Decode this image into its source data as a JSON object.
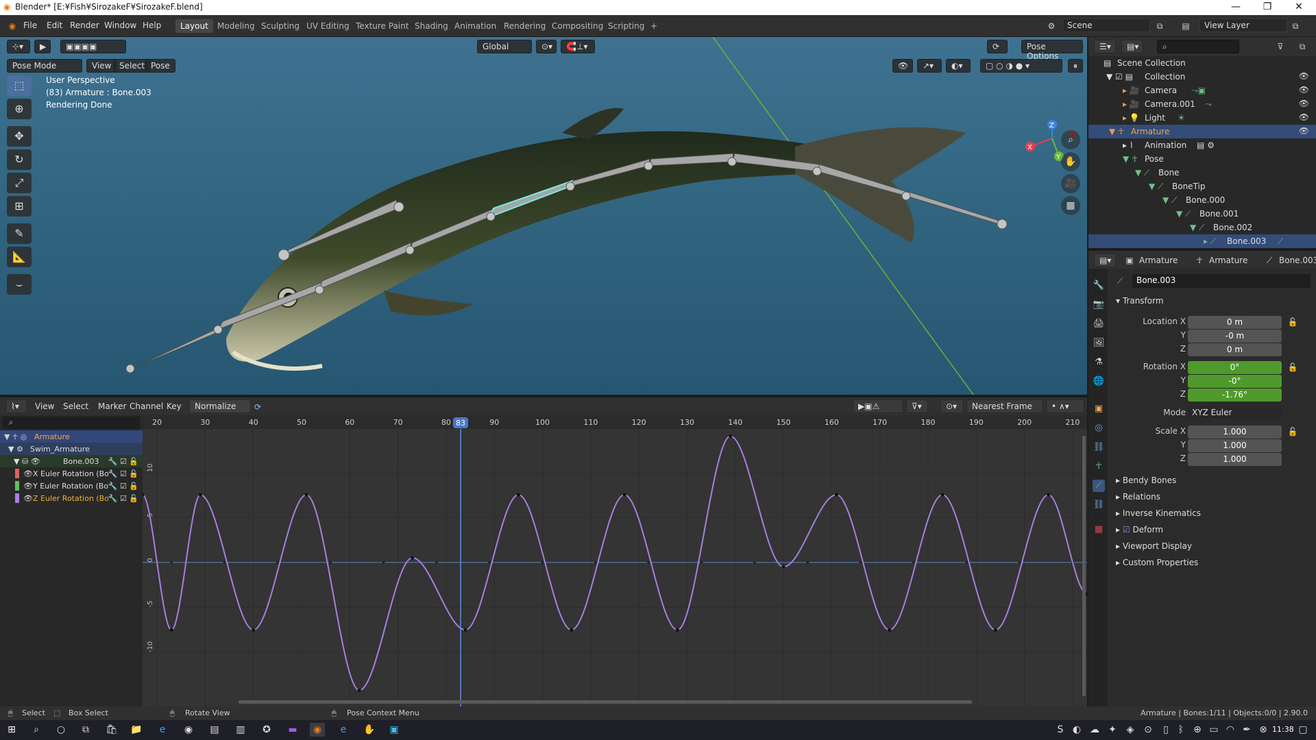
{
  "window": {
    "title": "Blender* [E:¥Fish¥SirozakeF¥SirozakeF.blend]"
  },
  "menu": [
    "File",
    "Edit",
    "Render",
    "Window",
    "Help"
  ],
  "workspaces": [
    "Layout",
    "Modeling",
    "Sculpting",
    "UV Editing",
    "Texture Paint",
    "Shading",
    "Animation",
    "Rendering",
    "Compositing",
    "Scripting",
    "+"
  ],
  "active_workspace": "Layout",
  "scene": {
    "label": "Scene",
    "view_layer": "View Layer"
  },
  "viewport": {
    "mode": "Pose Mode",
    "menus": [
      "View",
      "Select",
      "Pose"
    ],
    "orientation": "Global",
    "pose_options": "Pose Options",
    "info_line1": "User Perspective",
    "info_line2": "(83) Armature : Bone.003",
    "info_line3": "Rendering Done",
    "gizmo_axes": [
      "X",
      "Y",
      "Z"
    ]
  },
  "graph_editor": {
    "menus": [
      "View",
      "Select",
      "Marker",
      "Channel",
      "Key"
    ],
    "normalize": "Normalize",
    "snap": "Nearest Frame",
    "current_frame": 83,
    "frame_ticks": [
      20,
      30,
      40,
      50,
      60,
      70,
      80,
      90,
      100,
      110,
      120,
      130,
      140,
      150,
      160,
      170,
      180,
      190,
      200,
      210
    ],
    "value_ticks": [
      "10",
      "5",
      "0",
      "-5",
      "-10"
    ],
    "channels": [
      {
        "label": "Armature"
      },
      {
        "label": "Swim_Armature"
      },
      {
        "label": "Bone.003"
      },
      {
        "label": "X Euler Rotation (Bo"
      },
      {
        "label": "Y Euler Rotation (Bo"
      },
      {
        "label": "Z Euler Rotation (Bo"
      }
    ],
    "curve_color": "#a97fe0"
  },
  "chart_data": {
    "type": "line",
    "title": "",
    "xlabel": "",
    "ylabel": "",
    "xlim": [
      17,
      213
    ],
    "ylim": [
      -15,
      14.5
    ],
    "series": [
      {
        "name": "Z Euler Rotation",
        "x": [
          17,
          23,
          29,
          40,
          51,
          62,
          73,
          84,
          95,
          106,
          117,
          128,
          139,
          150,
          161,
          172,
          183,
          194,
          205,
          213
        ],
        "y": [
          7.5,
          -7.5,
          7.5,
          -7.5,
          7.5,
          -14.2,
          0.5,
          -7.5,
          7.5,
          -7.5,
          7.5,
          -7.5,
          14,
          -0.5,
          7.5,
          -7.5,
          7.5,
          -7.5,
          7.5,
          -3.5
        ]
      }
    ]
  },
  "outliner": {
    "rows": [
      {
        "label": "Scene Collection"
      },
      {
        "label": "Collection"
      },
      {
        "label": "Camera"
      },
      {
        "label": "Camera.001"
      },
      {
        "label": "Light"
      },
      {
        "label": "Armature"
      },
      {
        "label": "Animation"
      },
      {
        "label": "Pose"
      },
      {
        "label": "Bone"
      },
      {
        "label": "BoneTip"
      },
      {
        "label": "Bone.000"
      },
      {
        "label": "Bone.001"
      },
      {
        "label": "Bone.002"
      },
      {
        "label": "Bone.003"
      }
    ]
  },
  "properties": {
    "breadcrumb": [
      "Armature",
      "Armature",
      "Bone.003"
    ],
    "bone_name": "Bone.003",
    "transform_label": "Transform",
    "location_label": "Location X",
    "location": [
      "0 m",
      "-0 m",
      "0 m"
    ],
    "rotation_label": "Rotation X",
    "rotation": [
      "0°",
      "-0°",
      "-1.76°"
    ],
    "mode_label": "Mode",
    "mode": "XYZ Euler",
    "scale_label": "Scale X",
    "scale": [
      "1.000",
      "1.000",
      "1.000"
    ],
    "axis_y": "Y",
    "axis_z": "Z",
    "sections": [
      "Bendy Bones",
      "Relations",
      "Inverse Kinematics",
      "Deform",
      "Viewport Display",
      "Custom Properties"
    ]
  },
  "statusbar": {
    "select": "Select",
    "box_select": "Box Select",
    "rotate_view": "Rotate View",
    "context_menu": "Pose Context Menu",
    "stats": "Armature | Bones:1/11 | Objects:0/0 | 2.90.0"
  },
  "taskbar": {
    "time": "11:38"
  }
}
